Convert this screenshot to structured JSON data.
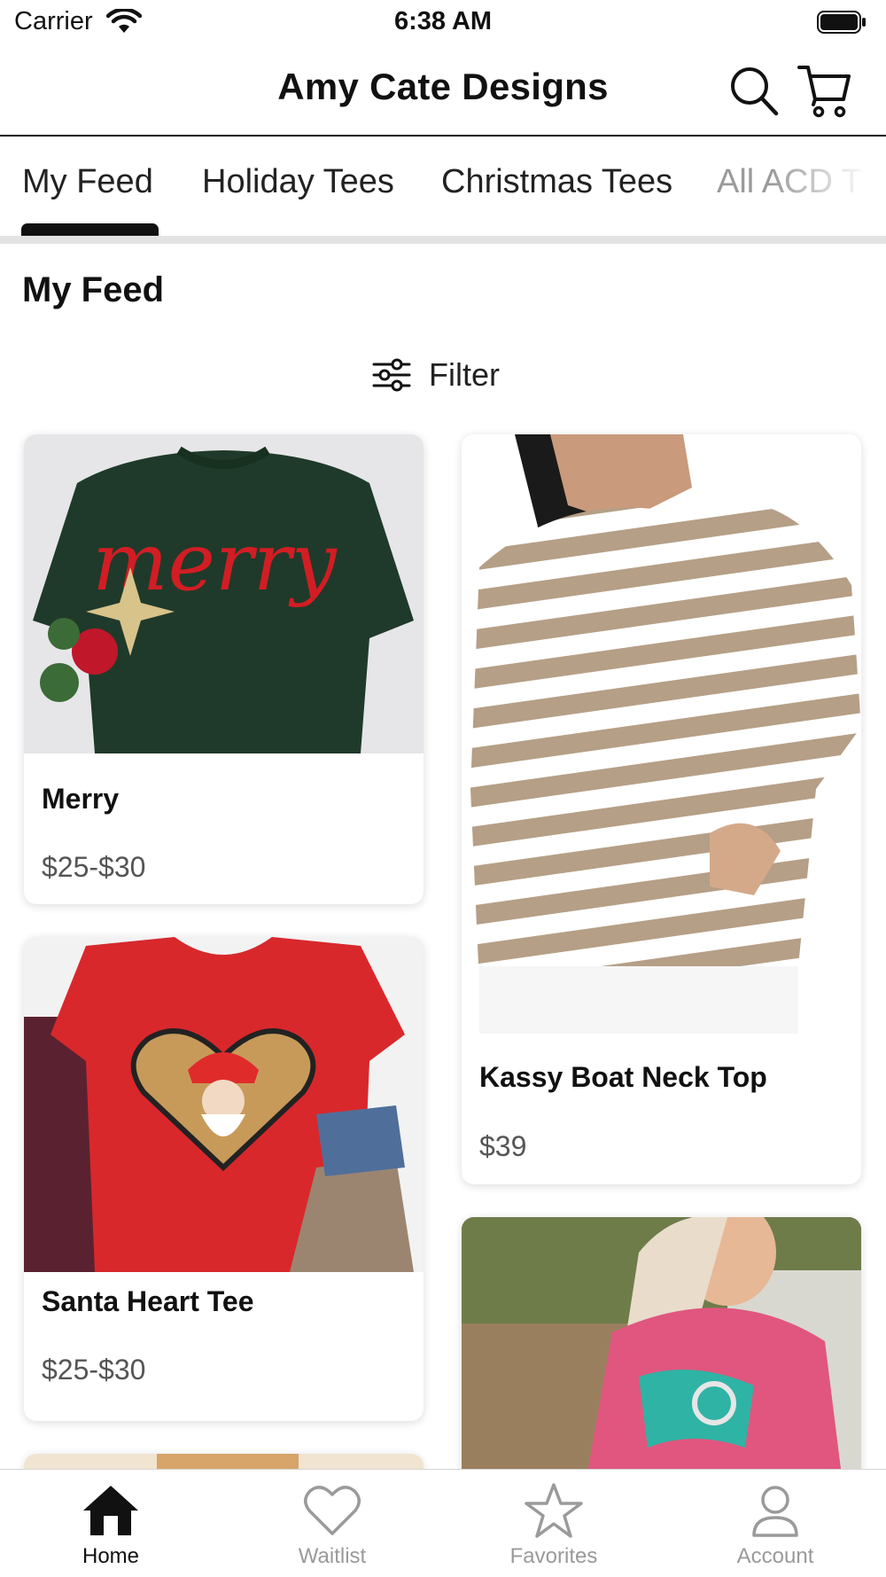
{
  "status_bar": {
    "carrier": "Carrier",
    "time": "6:38 AM"
  },
  "header": {
    "title": "Amy Cate Designs",
    "search_icon": "search-icon",
    "cart_icon": "cart-icon"
  },
  "tabs": [
    {
      "label": "My Feed",
      "active": true
    },
    {
      "label": "Holiday Tees"
    },
    {
      "label": "Christmas Tees"
    },
    {
      "label": "All ACD T"
    }
  ],
  "section_title": "My Feed",
  "filter": {
    "label": "Filter",
    "icon": "sliders-icon"
  },
  "products": [
    {
      "name": "Merry",
      "price": "$25-$30"
    },
    {
      "name": "Kassy Boat Neck Top",
      "price": "$39"
    },
    {
      "name": "Santa Heart Tee",
      "price": "$25-$30"
    }
  ],
  "bottom_nav": [
    {
      "label": "Home",
      "icon": "home-icon",
      "active": true
    },
    {
      "label": "Waitlist",
      "icon": "heart-icon"
    },
    {
      "label": "Favorites",
      "icon": "star-icon"
    },
    {
      "label": "Account",
      "icon": "person-icon"
    }
  ],
  "colors": {
    "accent": "#111111",
    "inactive": "#9a9a9a",
    "divider": "#e3e3e3"
  }
}
